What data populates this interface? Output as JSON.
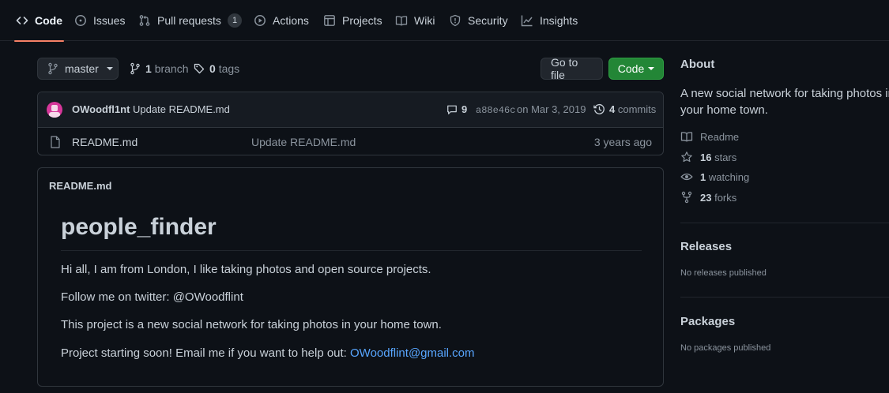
{
  "nav": {
    "tabs": [
      {
        "label": "Code",
        "icon": "code-icon",
        "active": true
      },
      {
        "label": "Issues",
        "icon": "issue-icon"
      },
      {
        "label": "Pull requests",
        "icon": "pull-request-icon",
        "count": "1"
      },
      {
        "label": "Actions",
        "icon": "play-icon"
      },
      {
        "label": "Projects",
        "icon": "table-icon"
      },
      {
        "label": "Wiki",
        "icon": "book-icon"
      },
      {
        "label": "Security",
        "icon": "shield-icon"
      },
      {
        "label": "Insights",
        "icon": "graph-icon"
      }
    ]
  },
  "branch_bar": {
    "branch": "master",
    "branch_count": "1",
    "branch_word": "branch",
    "tag_count": "0",
    "tag_word": "tags",
    "go_to_file": "Go to file",
    "code_button": "Code"
  },
  "latest_commit": {
    "author": "OWoodfl1nt",
    "message": "Update README.md",
    "comments": "9",
    "sha": "a88e46c",
    "date": "on Mar 3, 2019",
    "commit_count": "4",
    "commit_word": "commits"
  },
  "files": [
    {
      "name": "README.md",
      "message": "Update README.md",
      "age": "3 years ago",
      "icon": "file-icon"
    }
  ],
  "readme": {
    "header": "README.md",
    "title": "people_finder",
    "p1": "Hi all, I am from London, I like taking photos and open source projects.",
    "p2": "Follow me on twitter: @OWoodflint",
    "p3": "This project is a new social network for taking photos in your home town.",
    "p4_text": "Project starting soon! Email me if you want to help out: ",
    "p4_link": "OWoodflint@gmail.com"
  },
  "about": {
    "heading": "About",
    "description_line1": "A new social network for taking photos in",
    "description_line2": "your home town.",
    "readme_label": "Readme",
    "stars_count": "16",
    "stars_word": "stars",
    "watching_count": "1",
    "watching_word": "watching",
    "forks_count": "23",
    "forks_word": "forks"
  },
  "releases": {
    "heading": "Releases",
    "empty": "No releases published"
  },
  "packages": {
    "heading": "Packages",
    "empty": "No packages published"
  },
  "colors": {
    "background": "#0d1117",
    "accent_underline": "#f78166",
    "primary_button": "#238636",
    "link": "#58a6ff"
  }
}
